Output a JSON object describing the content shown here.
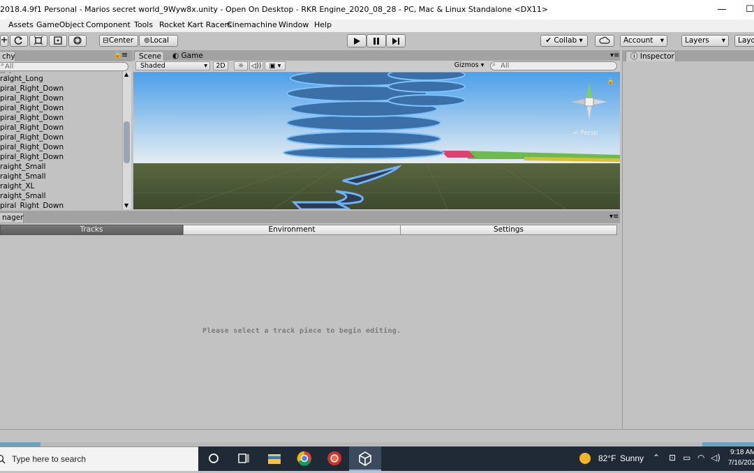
{
  "window": {
    "title": "2018.4.9f1 Personal - Marios secret world_9Wyw8x.unity - Open On Desktop - RKR Engine_2020_08_28 - PC, Mac & Linux Standalone <DX11>",
    "minimize": "—",
    "maximize": "☐"
  },
  "menu": [
    "Assets",
    "GameObject",
    "Component",
    "Tools",
    "Rocket Kart Racers",
    "Cinemachine",
    "Window",
    "Help"
  ],
  "toolbar": {
    "pivot": "Center",
    "space": "Local",
    "collab": "Collab ▾",
    "account": "Account",
    "layers": "Layers",
    "layout": "Layo"
  },
  "hierarchy": {
    "tab": "chy",
    "search_placeholder": "All",
    "items": [
      "raight_Long",
      "piral_Right_Down",
      "piral_Right_Down",
      "piral_Right_Down",
      "piral_Right_Down",
      "piral_Right_Down",
      "piral_Right_Down",
      "piral_Right_Down",
      "piral_Right_Down",
      "raight_Small",
      "raight_Small",
      "raight_XL",
      "raight_Small",
      "piral_Right_Down"
    ]
  },
  "scene": {
    "tabs": [
      "Scene",
      "Game"
    ],
    "shading": "Shaded",
    "mode2d": "2D",
    "gizmos": "Gizmos",
    "search_placeholder": "All",
    "persp": "< Persp"
  },
  "inspector": {
    "tab": "Inspector"
  },
  "manager": {
    "tab": "nager",
    "tabs": [
      "Tracks",
      "Environment",
      "Settings"
    ],
    "message": "Please select a track piece to begin editing."
  },
  "taskbar": {
    "search_placeholder": "Type here to search",
    "weather_temp": "82°F",
    "weather_desc": "Sunny",
    "time": "9:18 AM",
    "date": "7/16/202"
  }
}
